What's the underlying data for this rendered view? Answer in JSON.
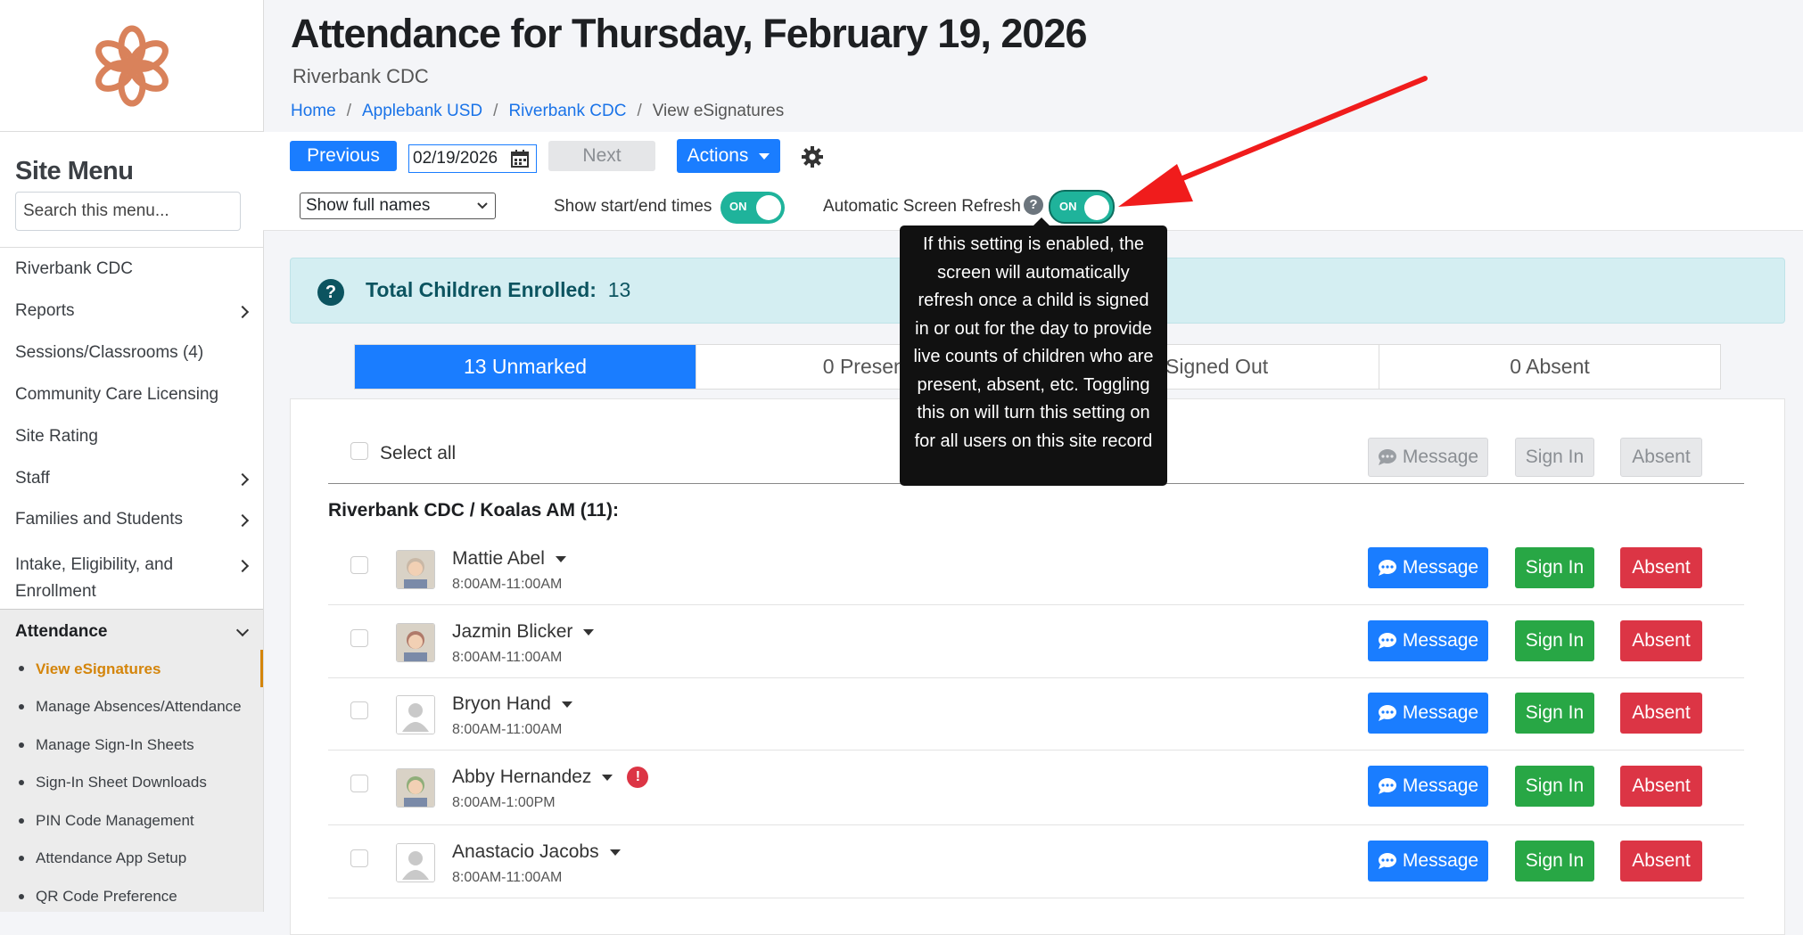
{
  "sidebar": {
    "title": "Site Menu",
    "search_placeholder": "Search this menu...",
    "items": [
      {
        "label": "Riverbank CDC"
      },
      {
        "label": "Reports"
      },
      {
        "label": "Sessions/Classrooms (4)"
      },
      {
        "label": "Community Care Licensing"
      },
      {
        "label": "Site Rating"
      },
      {
        "label": "Staff"
      },
      {
        "label": "Families and Students"
      },
      {
        "label": "Intake, Eligibility, and"
      },
      {
        "label": "Enrollment"
      },
      {
        "label": "Attendance"
      }
    ],
    "sub_items": [
      {
        "label": "View eSignatures"
      },
      {
        "label": "Manage Absences/Attendance"
      },
      {
        "label": "Manage Sign-In Sheets"
      },
      {
        "label": "Sign-In Sheet Downloads"
      },
      {
        "label": "PIN Code Management"
      },
      {
        "label": "Attendance App Setup"
      },
      {
        "label": "QR Code Preference"
      }
    ]
  },
  "header": {
    "title": "Attendance for Thursday, February 19, 2026",
    "subtitle": "Riverbank CDC",
    "breadcrumbs": [
      "Home",
      "Applebank USD",
      "Riverbank CDC",
      "View eSignatures"
    ],
    "separator": "/"
  },
  "toolbar": {
    "previous": "Previous",
    "date": "02/19/2026",
    "next": "Next",
    "actions": "Actions",
    "name_display": "Show full names",
    "show_times_label": "Show start/end times",
    "auto_refresh_label": "Automatic Screen Refresh",
    "toggle_on": "ON",
    "question": "?"
  },
  "tooltip": {
    "text": "If this setting is enabled, the screen will automatically refresh once a child is signed in or out for the day to provide live counts of children who are present, absent, etc. Toggling this on will turn this setting on for all users on this site record"
  },
  "summary": {
    "label": "Total Children Enrolled:",
    "count": "13",
    "icon": "?"
  },
  "tabs": [
    {
      "label": "13 Unmarked"
    },
    {
      "label": "0 Present"
    },
    {
      "label": "0 Signed Out"
    },
    {
      "label": "0 Absent"
    }
  ],
  "list": {
    "select_all": "Select all",
    "bulk_message": "Message",
    "bulk_sign_in": "Sign In",
    "bulk_absent": "Absent",
    "group_title": "Riverbank CDC / Koalas AM (11):",
    "message": "Message",
    "sign_in": "Sign In",
    "absent": "Absent",
    "alert_mark": "!",
    "children": [
      {
        "name": "Mattie Abel",
        "time": "8:00AM-11:00AM"
      },
      {
        "name": "Jazmin Blicker",
        "time": "8:00AM-11:00AM"
      },
      {
        "name": "Bryon Hand",
        "time": "8:00AM-11:00AM"
      },
      {
        "name": "Abby Hernandez",
        "time": "8:00AM-1:00PM"
      },
      {
        "name": "Anastacio Jacobs",
        "time": "8:00AM-11:00AM"
      }
    ]
  },
  "colors": {
    "primary": "#1a7dff",
    "success": "#28a745",
    "danger": "#dc3545",
    "accent": "#d4850b",
    "toggle": "#1fb39b",
    "annotation_arrow": "#f01c1c"
  }
}
